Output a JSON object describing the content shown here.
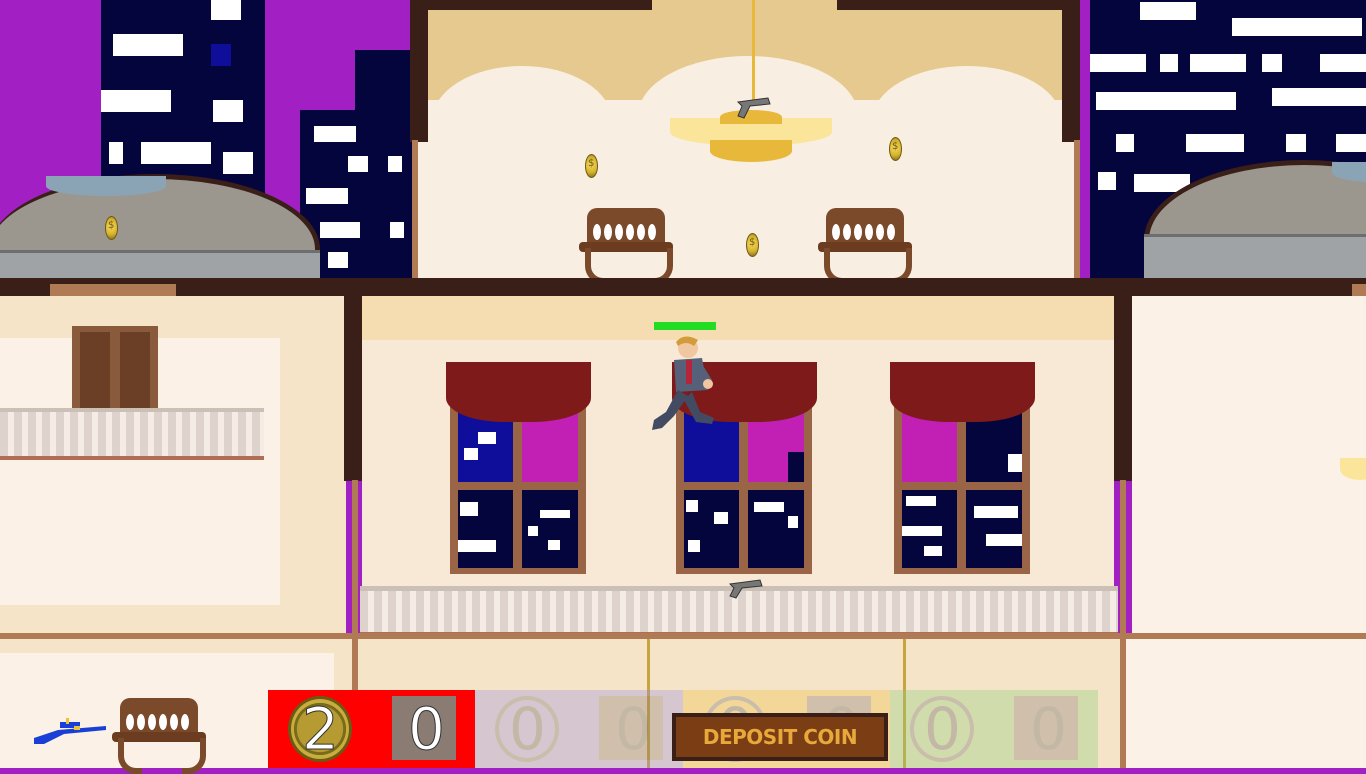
{
  "hud": {
    "coin_count": "2",
    "deposit_count": "0",
    "players": [
      {
        "coins": "0",
        "deposit": "0",
        "color": "#9c8fe0"
      },
      {
        "coins": "0",
        "deposit": "0",
        "color": "#f0c040"
      },
      {
        "coins": "0",
        "deposit": "0",
        "color": "#8fd07a"
      }
    ],
    "deposit_label": "DEPOSIT COIN",
    "player_color": "#ff0000",
    "deposit_box_color": "#8a7b73"
  },
  "player": {
    "health_pct": 100,
    "health_color": "#22dd22"
  },
  "weapon": {
    "name": "sniper-rifle-icon"
  },
  "scene": {
    "sky_color": "#a21fc4",
    "wall_color": "#f6e4c8"
  }
}
